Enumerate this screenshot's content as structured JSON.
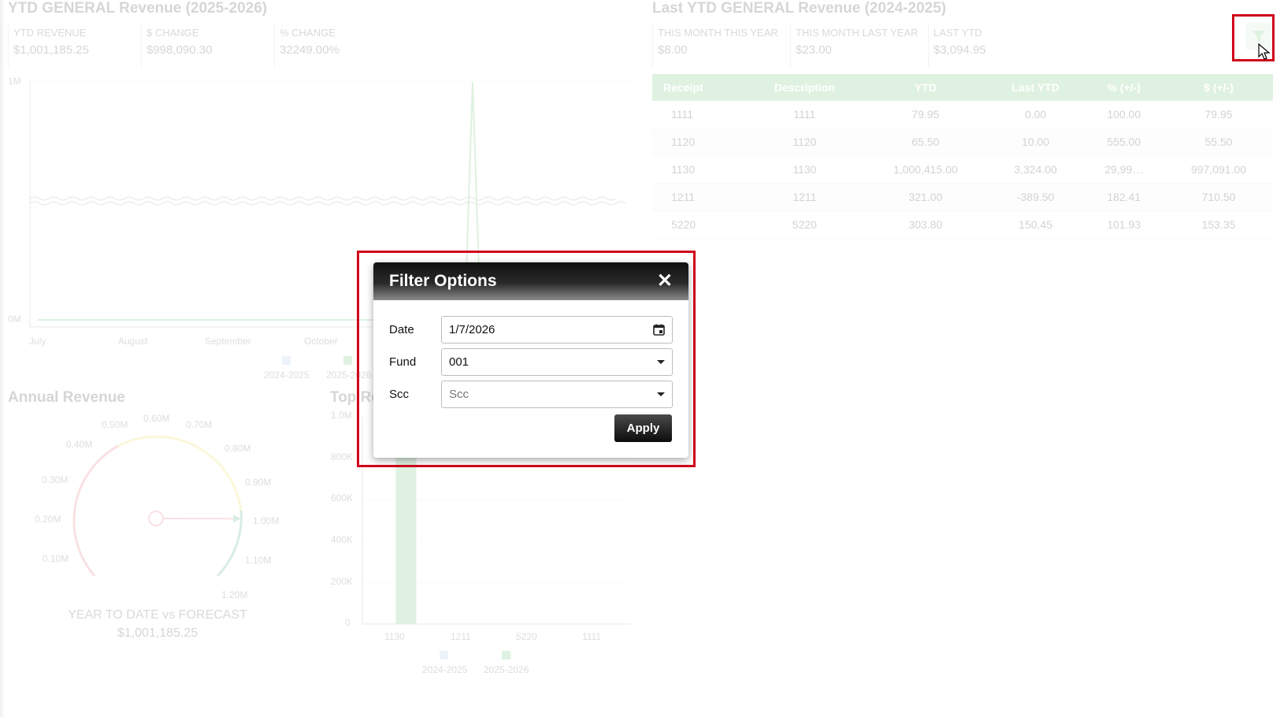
{
  "ytd_panel": {
    "title": "YTD GENERAL Revenue (2025-2026)",
    "kpis": [
      {
        "label": "YTD REVENUE",
        "value": "$1,001,185.25"
      },
      {
        "label": "$ CHANGE",
        "value": "$998,090.30"
      },
      {
        "label": "% CHANGE",
        "value": "32249.00%"
      }
    ],
    "chart_data": {
      "type": "line",
      "x": [
        "July",
        "August",
        "September",
        "October"
      ],
      "y_ticks": [
        "1M",
        "0M"
      ],
      "legend": [
        "2024-2025",
        "2025-2026"
      ]
    }
  },
  "last_ytd_panel": {
    "title": "Last YTD GENERAL Revenue (2024-2025)",
    "kpis": [
      {
        "label": "THIS MONTH THIS YEAR",
        "value": "$8.00"
      },
      {
        "label": "THIS MONTH LAST YEAR",
        "value": "$23.00"
      },
      {
        "label": "LAST YTD",
        "value": "$3,094.95"
      }
    ]
  },
  "receipt_table": {
    "headers": [
      "Receipt",
      "Description",
      "YTD",
      "Last YTD",
      "% (+/-)",
      "$ (+/-)"
    ],
    "rows": [
      [
        "1111",
        "1111",
        "79.95",
        "0.00",
        "100.00",
        "79.95"
      ],
      [
        "1120",
        "1120",
        "65.50",
        "10.00",
        "555.00",
        "55.50"
      ],
      [
        "1130",
        "1130",
        "1,000,415.00",
        "3,324.00",
        "29,99…",
        "997,091.00"
      ],
      [
        "1211",
        "1211",
        "321.00",
        "-389.50",
        "182.41",
        "710.50"
      ],
      [
        "5220",
        "5220",
        "303.80",
        "150.45",
        "101.93",
        "153.35"
      ]
    ]
  },
  "annual_panel": {
    "title": "Annual Revenue",
    "gauge_ticks": [
      "0.10M",
      "0.20M",
      "0.30M",
      "0.40M",
      "0.50M",
      "0.60M",
      "0.70M",
      "0.80M",
      "0.90M",
      "1.00M",
      "1.10M",
      "1.20M"
    ],
    "gauge_value_fraction": 0.834,
    "caption": "YEAR TO DATE vs FORECAST",
    "value": "$1,001,185.25"
  },
  "top_panel": {
    "title": "Top Re",
    "chart_data": {
      "type": "bar",
      "categories": [
        "1130",
        "1211",
        "5220",
        "1111"
      ],
      "series": [
        {
          "name": "2024-2025",
          "values": [
            3324,
            0,
            150,
            0
          ]
        },
        {
          "name": "2025-2026",
          "values": [
            1000415,
            321,
            304,
            80
          ]
        }
      ],
      "y_ticks": [
        "1.0M",
        "800K",
        "600K",
        "400K",
        "200K",
        "0"
      ],
      "ylim": [
        0,
        1000000
      ]
    }
  },
  "filter_modal": {
    "title": "Filter Options",
    "close": "✕",
    "date_label": "Date",
    "date_value": "1/7/2026",
    "fund_label": "Fund",
    "fund_value": "001",
    "scc_label": "Scc",
    "scc_placeholder": "Scc",
    "apply_label": "Apply"
  },
  "colors": {
    "series_2024": "#a9c9e6",
    "series_2025": "#6fbf73",
    "highlight": "#d0021b"
  },
  "icons": [
    "filter-icon",
    "calendar-icon",
    "close-icon",
    "cursor-icon"
  ]
}
